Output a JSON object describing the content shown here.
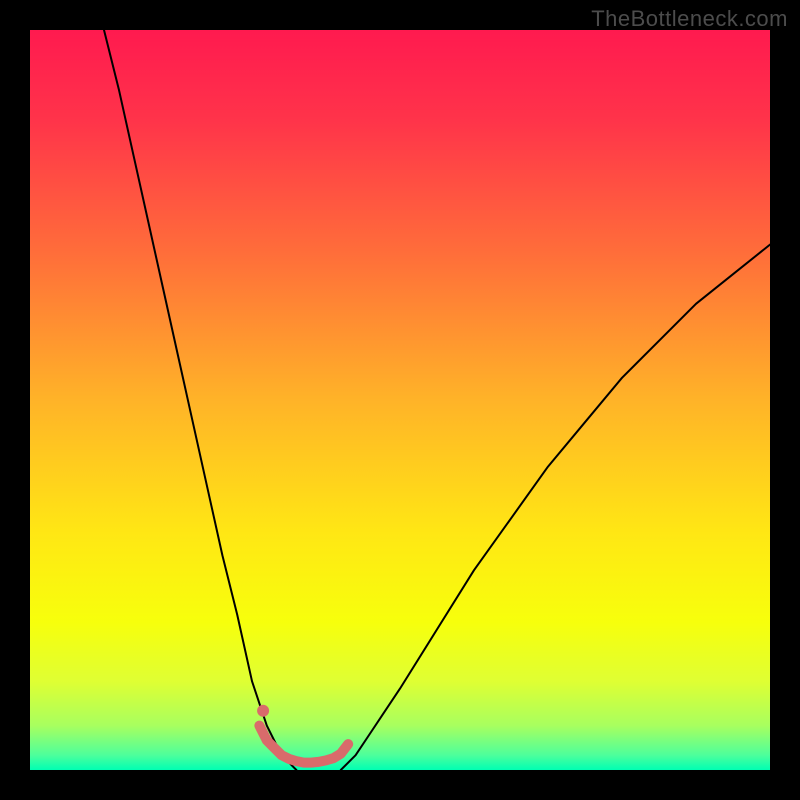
{
  "watermark": "TheBottleneck.com",
  "chart_data": {
    "type": "line",
    "title": "",
    "xlabel": "",
    "ylabel": "",
    "xlim": [
      0,
      100
    ],
    "ylim": [
      0,
      100
    ],
    "grid": false,
    "legend": false,
    "background_gradient": {
      "direction": "vertical",
      "stops": [
        {
          "pos": 0.0,
          "color": "#ff1a4f"
        },
        {
          "pos": 0.12,
          "color": "#ff334a"
        },
        {
          "pos": 0.3,
          "color": "#ff6d3a"
        },
        {
          "pos": 0.5,
          "color": "#ffb328"
        },
        {
          "pos": 0.68,
          "color": "#ffe714"
        },
        {
          "pos": 0.8,
          "color": "#f7ff0c"
        },
        {
          "pos": 0.88,
          "color": "#dfff33"
        },
        {
          "pos": 0.94,
          "color": "#a8ff5f"
        },
        {
          "pos": 0.98,
          "color": "#4dff9c"
        },
        {
          "pos": 1.0,
          "color": "#00ffb3"
        }
      ]
    },
    "series": [
      {
        "name": "bottleneck-left",
        "stroke": "#000000",
        "stroke_width": 2,
        "x": [
          10,
          12,
          14,
          16,
          18,
          20,
          22,
          24,
          26,
          28,
          30,
          31,
          32,
          33,
          34,
          35,
          36
        ],
        "y": [
          100,
          92,
          83,
          74,
          65,
          56,
          47,
          38,
          29,
          21,
          12,
          9,
          6,
          4,
          2,
          1,
          0
        ]
      },
      {
        "name": "bottleneck-right",
        "stroke": "#000000",
        "stroke_width": 2,
        "x": [
          42,
          44,
          46,
          50,
          55,
          60,
          65,
          70,
          75,
          80,
          85,
          90,
          95,
          100
        ],
        "y": [
          0,
          2,
          5,
          11,
          19,
          27,
          34,
          41,
          47,
          53,
          58,
          63,
          67,
          71
        ]
      },
      {
        "name": "optimal-range-marker",
        "stroke": "#d96b6b",
        "stroke_width": 10,
        "x": [
          31,
          32,
          33,
          34,
          35,
          36,
          37,
          38,
          39,
          40,
          41,
          42,
          43
        ],
        "y": [
          6,
          4,
          3,
          2,
          1.5,
          1.2,
          1.0,
          1.0,
          1.1,
          1.3,
          1.6,
          2.2,
          3.5
        ]
      }
    ],
    "points": [
      {
        "name": "marker-dot",
        "x": 31.5,
        "y": 8,
        "color": "#d96b6b",
        "r": 6
      }
    ]
  }
}
